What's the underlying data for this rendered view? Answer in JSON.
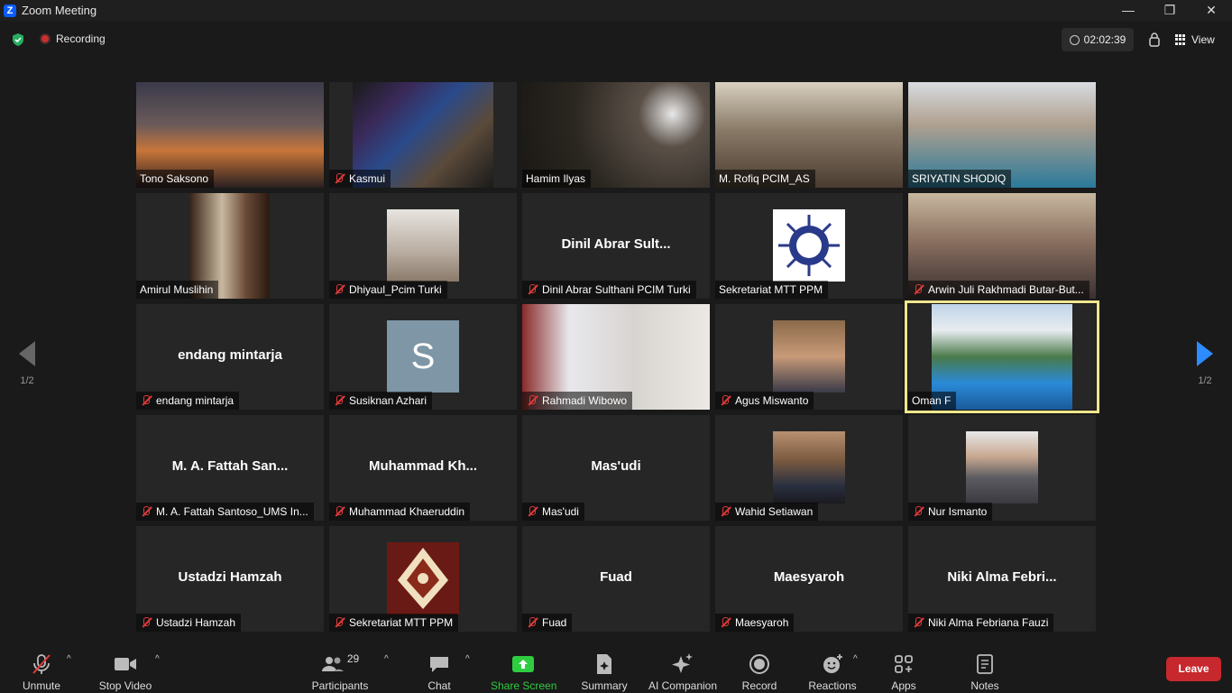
{
  "window": {
    "app_icon": "Z",
    "title": "Zoom Meeting",
    "minimize": "—",
    "restore": "❐",
    "close": "✕"
  },
  "topbar": {
    "recording_label": "Recording",
    "elapsed": "02:02:39",
    "view_label": "View"
  },
  "pagination": {
    "page": "1/2"
  },
  "tiles": [
    {
      "name": "Tono Saksono",
      "muted": false
    },
    {
      "name": "Kasmui",
      "muted": true
    },
    {
      "name": "Hamim Ilyas",
      "muted": false
    },
    {
      "name": "M. Rofiq PCIM_AS",
      "muted": false
    },
    {
      "name": "SRIYATIN SHODIQ",
      "muted": false
    },
    {
      "name": "Amirul Muslihin",
      "muted": false
    },
    {
      "name": "Dhiyaul_Pcim Turki",
      "muted": true
    },
    {
      "name": "Dinil Abrar Sulthani PCIM Turki",
      "display": "Dinil Abrar Sult...",
      "muted": true
    },
    {
      "name": "Sekretariat MTT PPM",
      "muted": false
    },
    {
      "name": "Arwin Juli Rakhmadi Butar-But...",
      "muted": true
    },
    {
      "name": "endang mintarja",
      "display": "endang mintarja",
      "muted": true
    },
    {
      "name": "Susiknan Azhari",
      "avatar_letter": "S",
      "muted": true
    },
    {
      "name": "Rahmadi Wibowo",
      "muted": true
    },
    {
      "name": "Agus Miswanto",
      "muted": true
    },
    {
      "name": "Oman F",
      "muted": false,
      "active_speaker": true
    },
    {
      "name": "M. A. Fattah Santoso_UMS In...",
      "display": "M. A. Fattah San...",
      "muted": true
    },
    {
      "name": "Muhammad Khaeruddin",
      "display": "Muhammad  Kh...",
      "muted": true
    },
    {
      "name": "Mas'udi",
      "display": "Mas'udi",
      "muted": true
    },
    {
      "name": "Wahid Setiawan",
      "muted": true
    },
    {
      "name": "Nur Ismanto",
      "muted": true
    },
    {
      "name": "Ustadzi Hamzah",
      "display": "Ustadzi Hamzah",
      "muted": true
    },
    {
      "name": "Sekretariat MTT PPM",
      "muted": true
    },
    {
      "name": "Fuad",
      "display": "Fuad",
      "muted": true
    },
    {
      "name": "Maesyaroh",
      "display": "Maesyaroh",
      "muted": true
    },
    {
      "name": "Niki Alma Febriana Fauzi",
      "display": "Niki Alma  Febri...",
      "muted": true
    }
  ],
  "toolbar": {
    "unmute": "Unmute",
    "stop_video": "Stop Video",
    "participants": "Participants",
    "participant_count": "29",
    "chat": "Chat",
    "share_screen": "Share Screen",
    "summary": "Summary",
    "ai_companion": "AI Companion",
    "record": "Record",
    "reactions": "Reactions",
    "apps": "Apps",
    "notes": "Notes",
    "leave": "Leave"
  },
  "colors": {
    "accent_blue": "#2d8cff",
    "share_green": "#2ecc40",
    "leave_red": "#c6282d",
    "mute_red": "#e03a3a",
    "active_border": "#f0e68c"
  }
}
